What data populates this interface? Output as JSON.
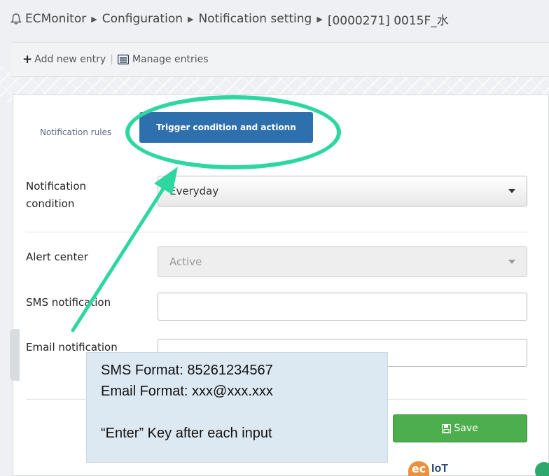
{
  "breadcrumb": {
    "items": [
      "ECMonitor",
      "Configuration",
      "Notification setting",
      "[0000271] 0015F_水"
    ]
  },
  "toolbar": {
    "add_label": "Add new entry",
    "divider": "|",
    "manage_label": "Manage entries"
  },
  "tabs": {
    "rules_label": "Notification rules",
    "trigger_label": "Trigger condition and actionn"
  },
  "form": {
    "notification_condition": {
      "label": "Notification condition",
      "value": "Everyday"
    },
    "alert_center": {
      "label": "Alert center",
      "value": "Active"
    },
    "sms_notification": {
      "label": "SMS notification",
      "value": ""
    },
    "email_notification": {
      "label": "Email notification",
      "value": ""
    },
    "save_label": "Save"
  },
  "annotation": {
    "line1": "SMS Format: 85261234567",
    "line2": "Email Format: xxx@xxx.xxx",
    "line3": "“Enter” Key after each input"
  },
  "logo": {
    "mark": "ec",
    "text": "IoT"
  },
  "colors": {
    "tab_active": "#2e6fae",
    "save_button": "#4cae4c",
    "highlight": "#2ed6a0",
    "annotation_bg": "#dce9f3",
    "logo_orange": "#e9923b"
  }
}
